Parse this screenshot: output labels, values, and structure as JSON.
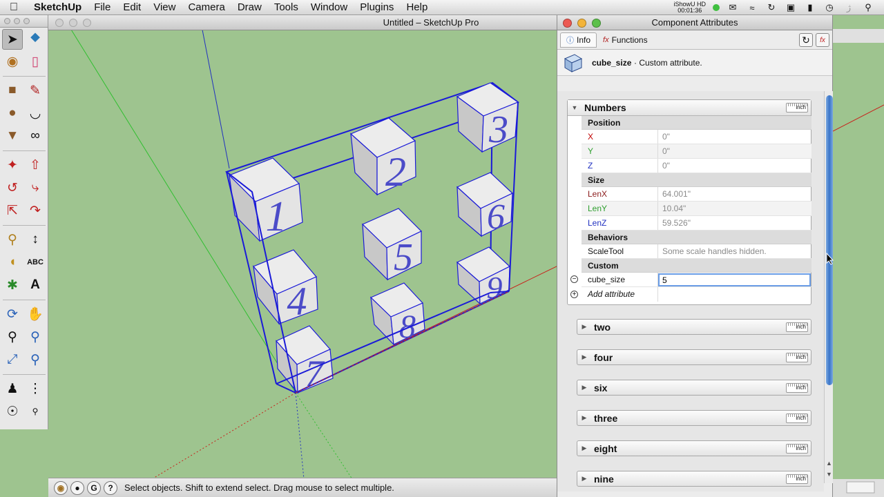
{
  "menubar": {
    "app_name": "SketchUp",
    "items": [
      "File",
      "Edit",
      "View",
      "Camera",
      "Draw",
      "Tools",
      "Window",
      "Plugins",
      "Help"
    ],
    "recorder_name": "iShowU HD",
    "recorder_time": "00:01:36"
  },
  "main_window": {
    "title": "Untitled – SketchUp Pro"
  },
  "status_bar": {
    "text": "Select objects. Shift to extend select. Drag mouse to select multiple."
  },
  "model": {
    "cube_labels": [
      "1",
      "2",
      "3",
      "4",
      "5",
      "6",
      "7",
      "8",
      "9"
    ],
    "colors": {
      "edge_selected": "#1a1ad8",
      "axis_green": "#2fbf2f",
      "axis_red": "#c8201a",
      "axis_blue": "#2030c0",
      "ground": "#9ec48f"
    }
  },
  "panel": {
    "title": "Component Attributes",
    "tabs": [
      {
        "label": "Info",
        "active": true
      },
      {
        "label": "Functions",
        "active": false
      }
    ],
    "header": {
      "name": "cube_size",
      "description": "· Custom attribute."
    },
    "unit_label": "inch",
    "numbers": {
      "title": "Numbers",
      "sections": [
        {
          "title": "Position",
          "rows": [
            {
              "key": "X",
              "value": "0\"",
              "color": "#c00000"
            },
            {
              "key": "Y",
              "value": "0\"",
              "color": "#2f9f2f"
            },
            {
              "key": "Z",
              "value": "0\"",
              "color": "#2030c0"
            }
          ]
        },
        {
          "title": "Size",
          "rows": [
            {
              "key": "LenX",
              "value": "64.001\"",
              "color": "#8a1a1a"
            },
            {
              "key": "LenY",
              "value": "10.04\"",
              "color": "#2f9f2f"
            },
            {
              "key": "LenZ",
              "value": "59.526\"",
              "color": "#2030c0"
            }
          ]
        },
        {
          "title": "Behaviors",
          "rows": [
            {
              "key": "ScaleTool",
              "value": "Some scale handles hidden.",
              "color": "#111111"
            }
          ]
        },
        {
          "title": "Custom",
          "rows": []
        }
      ],
      "custom_key": "cube_size",
      "custom_value": "5",
      "add_label": "Add attribute"
    },
    "groups": [
      "two",
      "four",
      "six",
      "three",
      "eight",
      "nine"
    ]
  }
}
